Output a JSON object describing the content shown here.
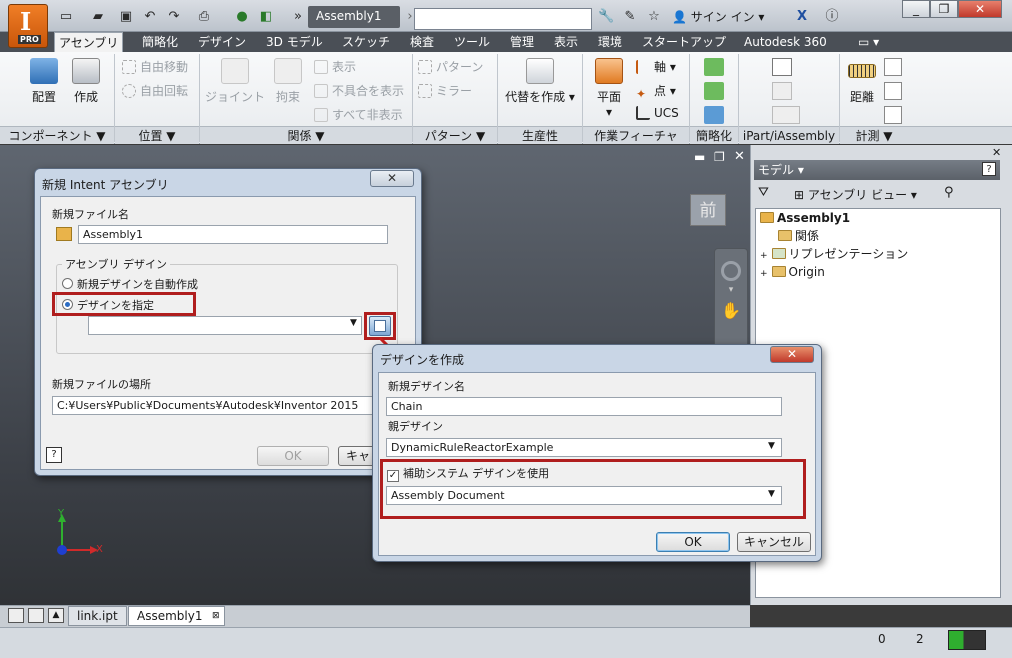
{
  "window": {
    "document_title": "Assembly1",
    "signin_label": "サイン イン",
    "app_badge": "PRO"
  },
  "ribbon": {
    "tabs": [
      "アセンブリ",
      "簡略化",
      "デザイン",
      "3D モデル",
      "スケッチ",
      "検査",
      "ツール",
      "管理",
      "表示",
      "環境",
      "スタートアップ",
      "Autodesk 360"
    ],
    "active_tab": "アセンブリ",
    "component": {
      "place": "配置",
      "create": "作成",
      "panel": "コンポーネント ▼"
    },
    "position": {
      "free_move": "自由移動",
      "free_rotate": "自由回転",
      "panel": "位置 ▼"
    },
    "relationships": {
      "joint": "ジョイント",
      "constrain": "拘束",
      "show": "表示",
      "show_sick": "不具合を表示",
      "hide_all": "すべて非表示",
      "panel": "関係 ▼"
    },
    "pattern": {
      "pattern": "パターン",
      "mirror": "ミラー",
      "panel": "パターン ▼"
    },
    "productivity": {
      "substitute": "代替を作成",
      "panel": "生産性"
    },
    "work_features": {
      "plane": "平面",
      "axis": "軸",
      "point": "点",
      "ucs": "UCS",
      "panel": "作業フィーチャ"
    },
    "simplify_panel": "簡略化",
    "ipart_panel": "iPart/iAssembly",
    "measure": {
      "distance": "距離",
      "panel": "計測 ▼"
    }
  },
  "viewcube_face": "前",
  "axis_labels": {
    "x": "X",
    "y": "Y"
  },
  "browser": {
    "title": "モデル ▾",
    "view_label": "アセンブリ ビュー",
    "tree": [
      {
        "label": "Assembly1",
        "bold": true
      },
      {
        "label": "関係"
      },
      {
        "label": "リプレゼンテーション",
        "expander": "+"
      },
      {
        "label": "Origin",
        "expander": "+"
      }
    ]
  },
  "doc_tabs": [
    "link.ipt",
    "Assembly1"
  ],
  "status": {
    "count_a": "0",
    "count_b": "2"
  },
  "dialog_intent": {
    "title": "新規 Intent アセンブリ",
    "file_name_label": "新規ファイル名",
    "file_name_value": "Assembly1",
    "group_label": "アセンブリ デザイン",
    "option_auto": "新規デザインを自動作成",
    "option_specify": "デザインを指定",
    "design_value": "",
    "location_label": "新規ファイルの場所",
    "location_value": "C:¥Users¥Public¥Documents¥Autodesk¥Inventor 2015",
    "ok": "OK",
    "cancel": "キャ"
  },
  "dialog_design": {
    "title": "デザインを作成",
    "name_label": "新規デザイン名",
    "name_value": "Chain",
    "parent_label": "親デザイン",
    "parent_value": "DynamicRuleReactorExample",
    "helper_label": "補助システム デザインを使用",
    "helper_value": "Assembly Document",
    "ok": "OK",
    "cancel": "キャンセル"
  }
}
